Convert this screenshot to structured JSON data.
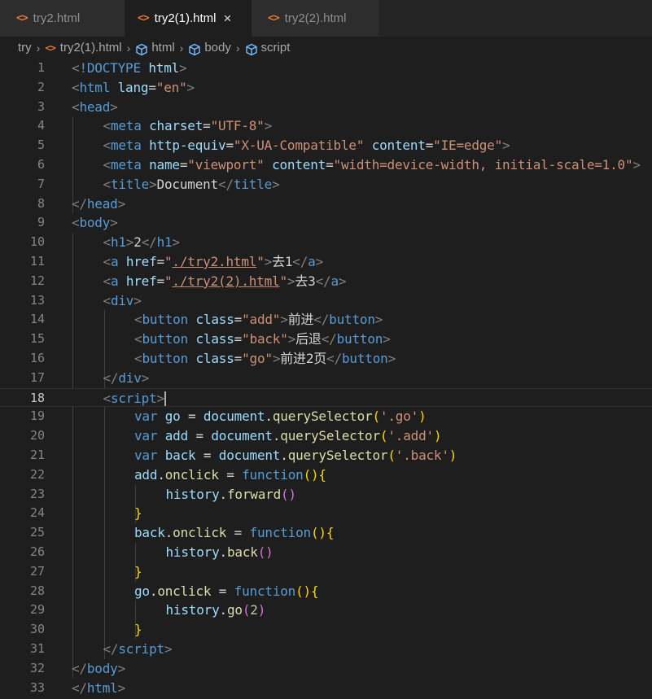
{
  "tabs": [
    {
      "icon": "<>",
      "label": "try2.html",
      "active": false
    },
    {
      "icon": "<>",
      "label": "try2(1).html",
      "active": true,
      "close": "×"
    },
    {
      "icon": "<>",
      "label": "try2(2).html",
      "active": false
    }
  ],
  "breadcrumb": {
    "folder": "try",
    "file": "try2(1).html",
    "html": "html",
    "body": "body",
    "script": "script",
    "separator": "›"
  },
  "editor": {
    "current_line": 18,
    "lines": [
      {
        "n": "1",
        "indent": 0,
        "tokens": [
          [
            "br",
            "<"
          ],
          [
            "tag",
            "!DOCTYPE "
          ],
          [
            "attr",
            "html"
          ],
          [
            "br",
            ">"
          ]
        ]
      },
      {
        "n": "2",
        "indent": 0,
        "tokens": [
          [
            "br",
            "<"
          ],
          [
            "tag",
            "html "
          ],
          [
            "attr",
            "lang"
          ],
          [
            "txt",
            "="
          ],
          [
            "str",
            "\"en\""
          ],
          [
            "br",
            ">"
          ]
        ]
      },
      {
        "n": "3",
        "indent": 0,
        "tokens": [
          [
            "br",
            "<"
          ],
          [
            "tag",
            "head"
          ],
          [
            "br",
            ">"
          ]
        ]
      },
      {
        "n": "4",
        "indent": 1,
        "tokens": [
          [
            "br",
            "<"
          ],
          [
            "tag",
            "meta "
          ],
          [
            "attr",
            "charset"
          ],
          [
            "txt",
            "="
          ],
          [
            "str",
            "\"UTF-8\""
          ],
          [
            "br",
            ">"
          ]
        ]
      },
      {
        "n": "5",
        "indent": 1,
        "tokens": [
          [
            "br",
            "<"
          ],
          [
            "tag",
            "meta "
          ],
          [
            "attr",
            "http-equiv"
          ],
          [
            "txt",
            "="
          ],
          [
            "str",
            "\"X-UA-Compatible\""
          ],
          [
            "txt",
            " "
          ],
          [
            "attr",
            "content"
          ],
          [
            "txt",
            "="
          ],
          [
            "str",
            "\"IE=edge\""
          ],
          [
            "br",
            ">"
          ]
        ]
      },
      {
        "n": "6",
        "indent": 1,
        "tokens": [
          [
            "br",
            "<"
          ],
          [
            "tag",
            "meta "
          ],
          [
            "attr",
            "name"
          ],
          [
            "txt",
            "="
          ],
          [
            "str",
            "\"viewport\""
          ],
          [
            "txt",
            " "
          ],
          [
            "attr",
            "content"
          ],
          [
            "txt",
            "="
          ],
          [
            "str",
            "\"width=device-width, initial-scale=1.0\""
          ],
          [
            "br",
            ">"
          ]
        ]
      },
      {
        "n": "7",
        "indent": 1,
        "tokens": [
          [
            "br",
            "<"
          ],
          [
            "tag",
            "title"
          ],
          [
            "br",
            ">"
          ],
          [
            "txt",
            "Document"
          ],
          [
            "br",
            "</"
          ],
          [
            "tag",
            "title"
          ],
          [
            "br",
            ">"
          ]
        ]
      },
      {
        "n": "8",
        "indent": 0,
        "tokens": [
          [
            "br",
            "</"
          ],
          [
            "tag",
            "head"
          ],
          [
            "br",
            ">"
          ]
        ]
      },
      {
        "n": "9",
        "indent": 0,
        "tokens": [
          [
            "br",
            "<"
          ],
          [
            "tag",
            "body"
          ],
          [
            "br",
            ">"
          ]
        ]
      },
      {
        "n": "10",
        "indent": 1,
        "tokens": [
          [
            "br",
            "<"
          ],
          [
            "tag",
            "h1"
          ],
          [
            "br",
            ">"
          ],
          [
            "txt",
            "2"
          ],
          [
            "br",
            "</"
          ],
          [
            "tag",
            "h1"
          ],
          [
            "br",
            ">"
          ]
        ]
      },
      {
        "n": "11",
        "indent": 1,
        "tokens": [
          [
            "br",
            "<"
          ],
          [
            "tag",
            "a "
          ],
          [
            "attr",
            "href"
          ],
          [
            "txt",
            "="
          ],
          [
            "str",
            "\""
          ],
          [
            "str link",
            "./try2.html"
          ],
          [
            "str",
            "\""
          ],
          [
            "br",
            ">"
          ],
          [
            "txt",
            "去1"
          ],
          [
            "br",
            "</"
          ],
          [
            "tag",
            "a"
          ],
          [
            "br",
            ">"
          ]
        ]
      },
      {
        "n": "12",
        "indent": 1,
        "tokens": [
          [
            "br",
            "<"
          ],
          [
            "tag",
            "a "
          ],
          [
            "attr",
            "href"
          ],
          [
            "txt",
            "="
          ],
          [
            "str",
            "\""
          ],
          [
            "str link",
            "./try2(2).html"
          ],
          [
            "str",
            "\""
          ],
          [
            "br",
            ">"
          ],
          [
            "txt",
            "去3"
          ],
          [
            "br",
            "</"
          ],
          [
            "tag",
            "a"
          ],
          [
            "br",
            ">"
          ]
        ]
      },
      {
        "n": "13",
        "indent": 1,
        "tokens": [
          [
            "br",
            "<"
          ],
          [
            "tag",
            "div"
          ],
          [
            "br",
            ">"
          ]
        ]
      },
      {
        "n": "14",
        "indent": 2,
        "tokens": [
          [
            "br",
            "<"
          ],
          [
            "tag",
            "button "
          ],
          [
            "attr",
            "class"
          ],
          [
            "txt",
            "="
          ],
          [
            "str",
            "\"add\""
          ],
          [
            "br",
            ">"
          ],
          [
            "txt",
            "前进"
          ],
          [
            "br",
            "</"
          ],
          [
            "tag",
            "button"
          ],
          [
            "br",
            ">"
          ]
        ]
      },
      {
        "n": "15",
        "indent": 2,
        "tokens": [
          [
            "br",
            "<"
          ],
          [
            "tag",
            "button "
          ],
          [
            "attr",
            "class"
          ],
          [
            "txt",
            "="
          ],
          [
            "str",
            "\"back\""
          ],
          [
            "br",
            ">"
          ],
          [
            "txt",
            "后退"
          ],
          [
            "br",
            "</"
          ],
          [
            "tag",
            "button"
          ],
          [
            "br",
            ">"
          ]
        ]
      },
      {
        "n": "16",
        "indent": 2,
        "tokens": [
          [
            "br",
            "<"
          ],
          [
            "tag",
            "button "
          ],
          [
            "attr",
            "class"
          ],
          [
            "txt",
            "="
          ],
          [
            "str",
            "\"go\""
          ],
          [
            "br",
            ">"
          ],
          [
            "txt",
            "前进2页"
          ],
          [
            "br",
            "</"
          ],
          [
            "tag",
            "button"
          ],
          [
            "br",
            ">"
          ]
        ]
      },
      {
        "n": "17",
        "indent": 1,
        "tokens": [
          [
            "br",
            "</"
          ],
          [
            "tag",
            "div"
          ],
          [
            "br",
            ">"
          ]
        ]
      },
      {
        "n": "18",
        "indent": 1,
        "tokens": [
          [
            "br",
            "<"
          ],
          [
            "tag",
            "script"
          ],
          [
            "br",
            ">"
          ]
        ]
      },
      {
        "n": "19",
        "indent": 2,
        "tokens": [
          [
            "kw",
            "var "
          ],
          [
            "var",
            "go"
          ],
          [
            "txt",
            " = "
          ],
          [
            "var",
            "document"
          ],
          [
            "txt",
            "."
          ],
          [
            "fn",
            "querySelector"
          ],
          [
            "p1",
            "("
          ],
          [
            "str",
            "'.go'"
          ],
          [
            "p1",
            ")"
          ]
        ]
      },
      {
        "n": "20",
        "indent": 2,
        "tokens": [
          [
            "kw",
            "var "
          ],
          [
            "var",
            "add"
          ],
          [
            "txt",
            " = "
          ],
          [
            "var",
            "document"
          ],
          [
            "txt",
            "."
          ],
          [
            "fn",
            "querySelector"
          ],
          [
            "p1",
            "("
          ],
          [
            "str",
            "'.add'"
          ],
          [
            "p1",
            ")"
          ]
        ]
      },
      {
        "n": "21",
        "indent": 2,
        "tokens": [
          [
            "kw",
            "var "
          ],
          [
            "var",
            "back"
          ],
          [
            "txt",
            " = "
          ],
          [
            "var",
            "document"
          ],
          [
            "txt",
            "."
          ],
          [
            "fn",
            "querySelector"
          ],
          [
            "p1",
            "("
          ],
          [
            "str",
            "'.back'"
          ],
          [
            "p1",
            ")"
          ]
        ]
      },
      {
        "n": "22",
        "indent": 2,
        "tokens": [
          [
            "var",
            "add"
          ],
          [
            "txt",
            "."
          ],
          [
            "fn",
            "onclick"
          ],
          [
            "txt",
            " = "
          ],
          [
            "kw",
            "function"
          ],
          [
            "p1",
            "(){"
          ]
        ]
      },
      {
        "n": "23",
        "indent": 3,
        "tokens": [
          [
            "var",
            "history"
          ],
          [
            "txt",
            "."
          ],
          [
            "fn",
            "forward"
          ],
          [
            "p2",
            "()"
          ]
        ]
      },
      {
        "n": "24",
        "indent": 2,
        "tokens": [
          [
            "p1",
            "}"
          ]
        ]
      },
      {
        "n": "25",
        "indent": 2,
        "tokens": [
          [
            "var",
            "back"
          ],
          [
            "txt",
            "."
          ],
          [
            "fn",
            "onclick"
          ],
          [
            "txt",
            " = "
          ],
          [
            "kw",
            "function"
          ],
          [
            "p1",
            "(){"
          ]
        ]
      },
      {
        "n": "26",
        "indent": 3,
        "tokens": [
          [
            "var",
            "history"
          ],
          [
            "txt",
            "."
          ],
          [
            "fn",
            "back"
          ],
          [
            "p2",
            "()"
          ]
        ]
      },
      {
        "n": "27",
        "indent": 2,
        "tokens": [
          [
            "p1",
            "}"
          ]
        ]
      },
      {
        "n": "28",
        "indent": 2,
        "tokens": [
          [
            "var",
            "go"
          ],
          [
            "txt",
            "."
          ],
          [
            "fn",
            "onclick"
          ],
          [
            "txt",
            " = "
          ],
          [
            "kw",
            "function"
          ],
          [
            "p1",
            "(){"
          ]
        ]
      },
      {
        "n": "29",
        "indent": 3,
        "tokens": [
          [
            "var",
            "history"
          ],
          [
            "txt",
            "."
          ],
          [
            "fn",
            "go"
          ],
          [
            "p2",
            "("
          ],
          [
            "num",
            "2"
          ],
          [
            "p2",
            ")"
          ]
        ]
      },
      {
        "n": "30",
        "indent": 2,
        "tokens": [
          [
            "p1",
            "}"
          ]
        ]
      },
      {
        "n": "31",
        "indent": 1,
        "tokens": [
          [
            "br",
            "</"
          ],
          [
            "tag",
            "script"
          ],
          [
            "br",
            ">"
          ]
        ]
      },
      {
        "n": "32",
        "indent": 0,
        "tokens": [
          [
            "br",
            "</"
          ],
          [
            "tag",
            "body"
          ],
          [
            "br",
            ">"
          ]
        ]
      },
      {
        "n": "33",
        "indent": 0,
        "tokens": [
          [
            "br",
            "</"
          ],
          [
            "tag",
            "html"
          ],
          [
            "br",
            ">"
          ]
        ]
      }
    ]
  }
}
